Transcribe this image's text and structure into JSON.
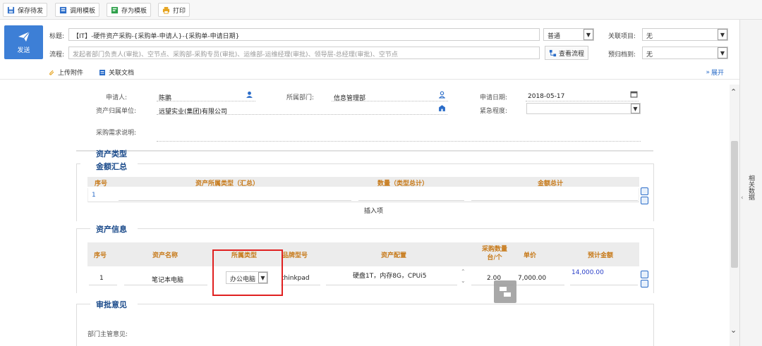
{
  "toolbar": {
    "buttons": [
      {
        "label": "保存待发",
        "icon": "save-icon"
      },
      {
        "label": "调用模板",
        "icon": "template-icon"
      },
      {
        "label": "存为模板",
        "icon": "save-template-icon"
      },
      {
        "label": "打印",
        "icon": "print-icon"
      }
    ]
  },
  "header": {
    "send_label": "发送",
    "title_label": "标题:",
    "title_value": "【IT】-硬件资产采购-{采购单-申请人}-{采购单-申请日期}",
    "priority_value": "普通",
    "related_project_label": "关联项目:",
    "related_project_value": "无",
    "flow_label": "流程:",
    "flow_placeholder": "发起者部门负责人(审批)、空节点、采购部-采购专员(审批)、运维部-运维经理(审批)、领导层-总经理(审批)、空节点",
    "view_flow_label": "查看流程",
    "archive_label": "预归档到:",
    "archive_value": "无",
    "attach_label": "上传附件",
    "related_doc_label": "关联文档",
    "expand_label": "展开"
  },
  "form": {
    "applicant_label": "申请人:",
    "applicant_value": "陈鹏",
    "dept_label": "所属部门:",
    "dept_value": "信息管理部",
    "date_label": "申请日期:",
    "date_value": "2018-05-17",
    "owner_label": "资产归属单位:",
    "owner_value": "远望实业(集团)有限公司",
    "urgency_label": "紧急程度:",
    "desc_label": "采购需求说明:"
  },
  "summary": {
    "title_line1": "资产类型",
    "title_line2": "金额汇总",
    "columns": [
      "序号",
      "资产所属类型（汇总）",
      "数量（类型总计）",
      "金额总计"
    ],
    "row_index": "1",
    "insert_label": "插入项"
  },
  "assets": {
    "title": "资产信息",
    "columns": [
      "序号",
      "资产名称",
      "所属类型",
      "品牌型号",
      "资产配置",
      "采购数量台/个",
      "单价",
      "预计金额"
    ],
    "row": {
      "index": "1",
      "name": "笔记本电脑",
      "type": "办公电脑",
      "brand": "thinkpad",
      "config": "硬盘1T，内存8G，CPUi5",
      "quantity": "2.00",
      "unit_price": "7,000.00",
      "amount": "14,000.00"
    }
  },
  "approval": {
    "title": "审批意见",
    "dept_head_label": "部门主管意见:"
  },
  "side_panel": {
    "label": "相关数据"
  },
  "colors": {
    "primary": "#3d7fd6",
    "section_title": "#1a4a8a",
    "header_text": "#c77a1a",
    "highlight": "#e02020"
  }
}
